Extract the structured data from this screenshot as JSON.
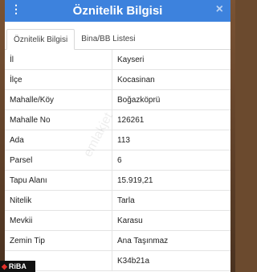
{
  "header": {
    "title": "Öznitelik Bilgisi",
    "menu_icon": "⋮",
    "close_icon": "×"
  },
  "tabs": [
    {
      "label": "Öznitelik Bilgisi",
      "active": true
    },
    {
      "label": "Bina/BB Listesi",
      "active": false
    }
  ],
  "rows": [
    {
      "key": "İl",
      "value": "Kayseri"
    },
    {
      "key": "İlçe",
      "value": "Kocasinan"
    },
    {
      "key": "Mahalle/Köy",
      "value": "Boğazköprü"
    },
    {
      "key": "Mahalle No",
      "value": "126261"
    },
    {
      "key": "Ada",
      "value": "113"
    },
    {
      "key": "Parsel",
      "value": "6"
    },
    {
      "key": "Tapu Alanı",
      "value": "15.919,21"
    },
    {
      "key": "Nitelik",
      "value": "Tarla"
    },
    {
      "key": "Mevkii",
      "value": "Karasu"
    },
    {
      "key": "Zemin Tip",
      "value": "Ana Taşınmaz"
    },
    {
      "key": "",
      "value": "K34b21a"
    }
  ],
  "watermark": "emlakjet",
  "logo": {
    "mark": "◆",
    "text": "RiBA"
  },
  "colors": {
    "header": "#3d82dd",
    "close": "#b9d1f3"
  }
}
